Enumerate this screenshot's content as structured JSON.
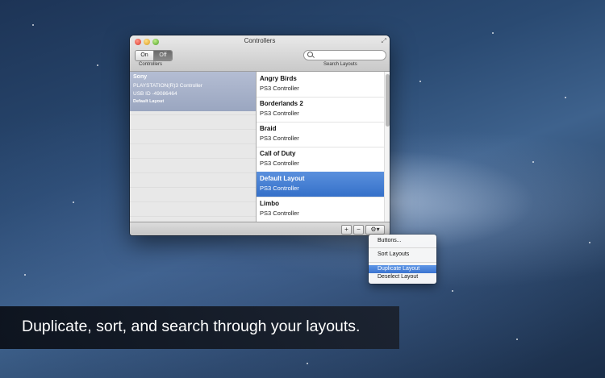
{
  "window": {
    "title": "Controllers",
    "toggle": {
      "on_label": "On",
      "off_label": "Off",
      "caption": "Controllers"
    },
    "search": {
      "placeholder": "",
      "caption": "Search Layouts"
    }
  },
  "device": {
    "name": "Sony",
    "model": "PLAYSTATION(R)3 Controller",
    "usb_id": "USB ID -49086464",
    "layout": "Default Layout"
  },
  "layouts": [
    {
      "title": "Angry Birds",
      "sub": "PS3 Controller"
    },
    {
      "title": "Borderlands 2",
      "sub": "PS3 Controller"
    },
    {
      "title": "Braid",
      "sub": "PS3 Controller"
    },
    {
      "title": "Call of Duty",
      "sub": "PS3 Controller"
    },
    {
      "title": "Default Layout",
      "sub": "PS3 Controller",
      "selected": true
    },
    {
      "title": "Limbo",
      "sub": "PS3 Controller"
    }
  ],
  "toolbar": {
    "add_label": "+",
    "remove_label": "−",
    "gear_label": "⚙▾"
  },
  "menu": {
    "items": [
      "Buttons...",
      "Sort Layouts",
      "Duplicate Layout",
      "Deselect Layout"
    ],
    "highlighted": "Duplicate Layout"
  },
  "banner": {
    "text": "Duplicate, sort, and search through your layouts."
  },
  "colors": {
    "selection": "#3570c9",
    "device_highlight": "#9aa6c0"
  }
}
